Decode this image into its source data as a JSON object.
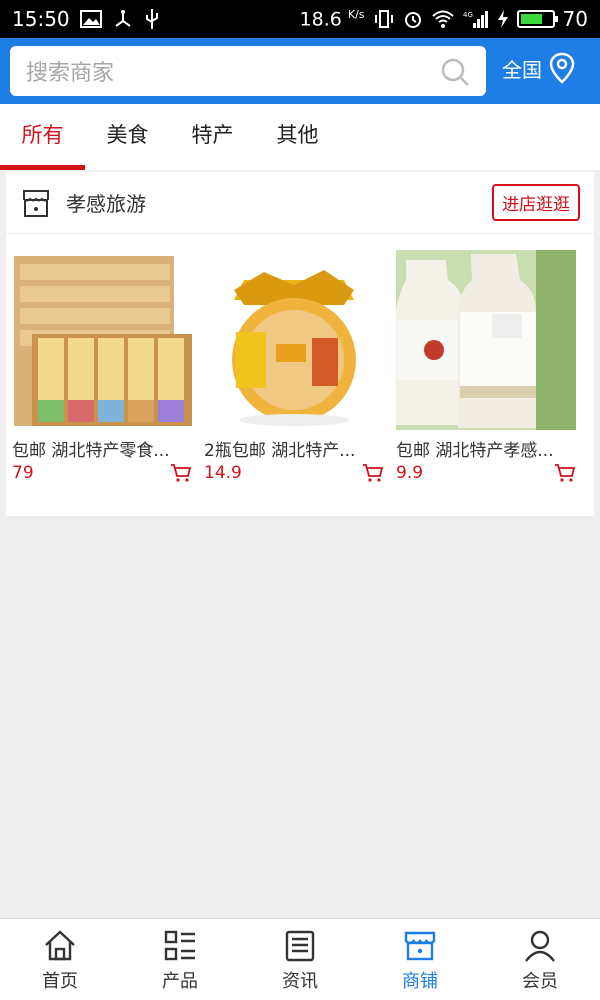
{
  "status_bar": {
    "time": "15:50",
    "speed": "18.6",
    "speed_unit": "K/s",
    "battery": "70",
    "network": "4G"
  },
  "search": {
    "placeholder": "搜索商家"
  },
  "region": {
    "label": "全国"
  },
  "tabs": [
    {
      "label": "所有",
      "active": true
    },
    {
      "label": "美食",
      "active": false
    },
    {
      "label": "特产",
      "active": false
    },
    {
      "label": "其他",
      "active": false
    }
  ],
  "shop": {
    "name": "孝感旅游",
    "enter_label": "进店逛逛",
    "products": [
      {
        "title": "包邮 湖北特产零食...",
        "price": "79"
      },
      {
        "title": "2瓶包邮 湖北特产...",
        "price": "14.9"
      },
      {
        "title": "包邮 湖北特产孝感...",
        "price": "9.9"
      }
    ]
  },
  "bottom_nav": [
    {
      "label": "首页",
      "icon": "home-icon",
      "active": false
    },
    {
      "label": "产品",
      "icon": "grid-list-icon",
      "active": false
    },
    {
      "label": "资讯",
      "icon": "news-icon",
      "active": false
    },
    {
      "label": "商铺",
      "icon": "store-icon",
      "active": true
    },
    {
      "label": "会员",
      "icon": "user-icon",
      "active": false
    }
  ],
  "colors": {
    "brand_blue": "#1e7ee6",
    "accent_red": "#d0121b"
  }
}
